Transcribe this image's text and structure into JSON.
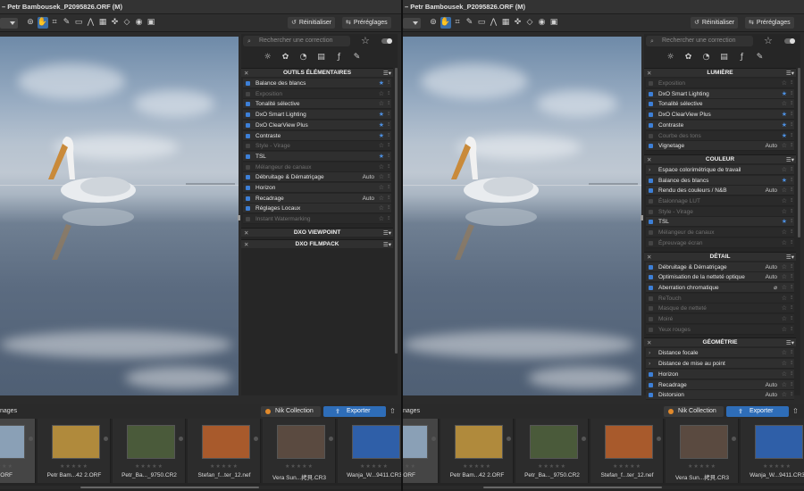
{
  "window": {
    "title": "– Petr Bambousek_P2095826.ORF (M)"
  },
  "toolbar": {
    "reset_label": "Réinitialiser",
    "presets_label": "Préréglages",
    "tools": [
      "compare-icon",
      "hand-icon",
      "crop-icon",
      "eyedropper-icon",
      "ruler-icon",
      "perspective-icon",
      "grid-icon",
      "repair-icon",
      "local-adjust-icon",
      "view-icon",
      "display-icon"
    ]
  },
  "panel": {
    "search_placeholder": "Rechercher une correction",
    "tabs": [
      "light-icon",
      "color-icon",
      "detail-icon",
      "geometry-icon",
      "fx-icon",
      "brush-icon"
    ]
  },
  "left": {
    "sections": [
      {
        "title": "OUTILS ÉLÉMENTAIRES",
        "items": [
          {
            "label": "Balance des blancs",
            "on": true,
            "star": true,
            "auto": ""
          },
          {
            "label": "Exposition",
            "on": false,
            "star": false,
            "auto": "",
            "dim": true
          },
          {
            "label": "Tonalité sélective",
            "on": true,
            "star": false,
            "auto": ""
          },
          {
            "label": "DxO Smart Lighting",
            "on": true,
            "star": true,
            "auto": ""
          },
          {
            "label": "DxO ClearView Plus",
            "on": true,
            "star": true,
            "auto": ""
          },
          {
            "label": "Contraste",
            "on": true,
            "star": true,
            "auto": ""
          },
          {
            "label": "Style - Virage",
            "on": false,
            "star": false,
            "auto": "",
            "dim": true
          },
          {
            "label": "TSL",
            "on": true,
            "star": true,
            "auto": ""
          },
          {
            "label": "Mélangeur de canaux",
            "on": false,
            "star": false,
            "auto": "",
            "dim": true
          },
          {
            "label": "Débruitage & Dématriçage",
            "on": true,
            "star": false,
            "auto": "Auto"
          },
          {
            "label": "Horizon",
            "on": true,
            "star": false,
            "auto": ""
          },
          {
            "label": "Recadrage",
            "on": true,
            "star": false,
            "auto": "Auto"
          },
          {
            "label": "Réglages Locaux",
            "on": true,
            "star": false,
            "auto": ""
          },
          {
            "label": "Instant Watermarking",
            "on": false,
            "star": false,
            "auto": "",
            "dim": true
          }
        ]
      },
      {
        "title": "DXO VIEWPOINT",
        "items": []
      },
      {
        "title": "DXO FILMPACK",
        "items": []
      }
    ]
  },
  "right": {
    "sections": [
      {
        "title": "LUMIÈRE",
        "items": [
          {
            "label": "Exposition",
            "dim": true,
            "on": false,
            "star": false,
            "auto": ""
          },
          {
            "label": "DxO Smart Lighting",
            "on": true,
            "star": true,
            "auto": ""
          },
          {
            "label": "Tonalité sélective",
            "on": true,
            "star": false,
            "auto": ""
          },
          {
            "label": "DxO ClearView Plus",
            "on": true,
            "star": true,
            "auto": ""
          },
          {
            "label": "Contraste",
            "on": true,
            "star": true,
            "auto": ""
          },
          {
            "label": "Courbe des tons",
            "dim": true,
            "on": false,
            "star": true,
            "auto": ""
          },
          {
            "label": "Vignetage",
            "on": true,
            "star": false,
            "auto": "Auto"
          }
        ]
      },
      {
        "title": "COULEUR",
        "items": [
          {
            "label": "Espace colorimétrique de travail",
            "arrow": true,
            "on": false,
            "star": false,
            "auto": ""
          },
          {
            "label": "Balance des blancs",
            "on": true,
            "star": true,
            "auto": ""
          },
          {
            "label": "Rendu des couleurs / N&B",
            "on": true,
            "star": false,
            "auto": "Auto"
          },
          {
            "label": "Étalonnage LUT",
            "dim": true,
            "on": false,
            "star": false,
            "auto": ""
          },
          {
            "label": "Style - Virage",
            "dim": true,
            "on": false,
            "star": false,
            "auto": ""
          },
          {
            "label": "TSL",
            "on": true,
            "star": true,
            "auto": ""
          },
          {
            "label": "Mélangeur de canaux",
            "dim": true,
            "on": false,
            "star": false,
            "auto": ""
          },
          {
            "label": "Épreuvage écran",
            "dim": true,
            "on": false,
            "star": false,
            "auto": ""
          }
        ]
      },
      {
        "title": "DÉTAIL",
        "items": [
          {
            "label": "Débruitage & Dématriçage",
            "on": true,
            "star": false,
            "auto": "Auto"
          },
          {
            "label": "Optimisation de la netteté optique",
            "on": true,
            "star": false,
            "auto": "Auto"
          },
          {
            "label": "Aberration chromatique",
            "on": true,
            "star": false,
            "auto": "⌀"
          },
          {
            "label": "ReTouch",
            "dim": true,
            "on": false,
            "star": false,
            "auto": ""
          },
          {
            "label": "Masque de netteté",
            "dim": true,
            "on": false,
            "star": false,
            "auto": ""
          },
          {
            "label": "Moiré",
            "dim": true,
            "on": false,
            "star": false,
            "auto": ""
          },
          {
            "label": "Yeux rouges",
            "dim": true,
            "on": false,
            "star": false,
            "auto": ""
          }
        ]
      },
      {
        "title": "GÉOMÉTRIE",
        "items": [
          {
            "label": "Distance focale",
            "arrow": true,
            "on": false,
            "star": false,
            "auto": ""
          },
          {
            "label": "Distance de mise au point",
            "arrow": true,
            "on": false,
            "star": false,
            "auto": ""
          },
          {
            "label": "Horizon",
            "on": true,
            "star": false,
            "auto": ""
          },
          {
            "label": "Recadrage",
            "on": true,
            "star": false,
            "auto": "Auto"
          },
          {
            "label": "Distorsion",
            "on": true,
            "star": false,
            "auto": "Auto"
          }
        ]
      }
    ]
  },
  "filmstrip": {
    "label": "nages",
    "nik_label": "Nik Collection",
    "export_label": "Exporter",
    "thumbs": [
      {
        "name": "5826.ORF",
        "color": "#8aa0b6"
      },
      {
        "name": "Petr Bam...42 2.ORF",
        "color": "#b08a3c"
      },
      {
        "name": "Petr_Ba..._9750.CR2",
        "color": "#4a5a3a"
      },
      {
        "name": "Stefan_f...ter_12.nef",
        "color": "#a85a2c"
      },
      {
        "name": "Vera Sun...拷貝.CR3",
        "color": "#5a4a40"
      },
      {
        "name": "Wanja_W...9411.CR3",
        "color": "#2f5fa8"
      }
    ]
  },
  "stars_text": "★★★★★"
}
